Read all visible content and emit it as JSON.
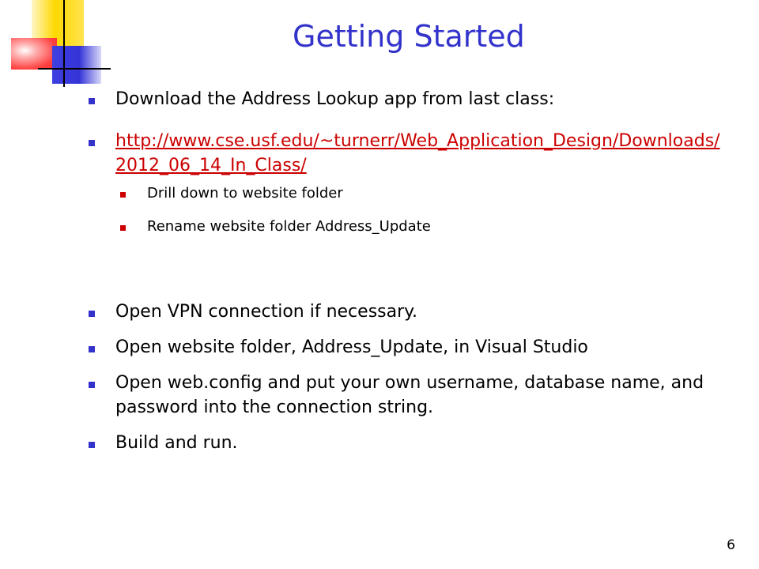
{
  "slide": {
    "title": "Getting Started",
    "page_number": "6",
    "bullets": [
      {
        "text": "Download  the Address Lookup app from last class:"
      },
      {
        "link": "http://www.cse.usf.edu/~turnerr/Web_Application_Design/Downloads/2012_06_14_In_Class/"
      },
      {
        "text": "Drill down to website folder"
      },
      {
        "text": "Rename website folder Address_Update"
      },
      {
        "text": "Open VPN connection if necessary."
      },
      {
        "text": "Open website folder, Address_Update, in Visual Studio"
      },
      {
        "text": "Open web.config and put your own username, database name, and password into the connection string."
      },
      {
        "text": "Build and run."
      }
    ]
  },
  "colors": {
    "title": "#3333cc",
    "bullet_marker": "#3333cc",
    "sub_bullet_marker": "#cc0000",
    "link": "#cc0000",
    "logo_yellow": "#ffd800",
    "logo_red": "#ff2a2a",
    "logo_blue": "#3434d8"
  }
}
